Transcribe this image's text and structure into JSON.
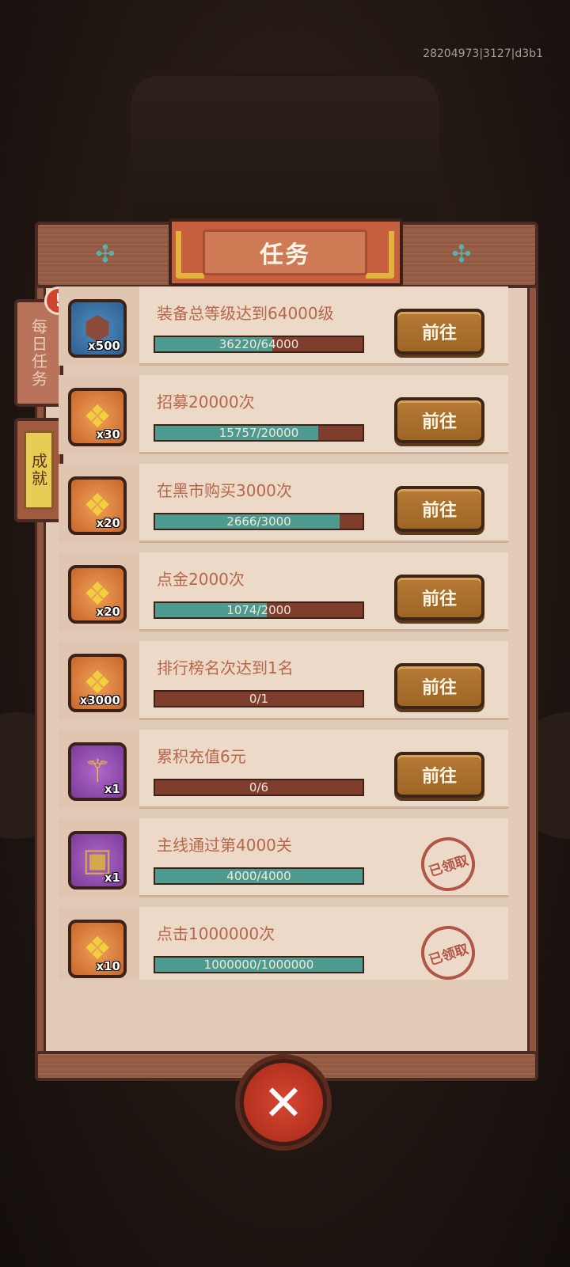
{
  "build_id": "28204973|3127|d3b1",
  "title": "任务",
  "tabs": {
    "daily": "每日任务",
    "achievement": "成就"
  },
  "alert_badge": "!",
  "tasks": [
    {
      "name": "装备总等级达到64000级",
      "reward_count": "x500",
      "reward_icon": "equipment-stone-icon",
      "progress_text": "36220/64000",
      "progress": 0.566,
      "action": "前往",
      "claimed": false
    },
    {
      "name": "招募20000次",
      "reward_count": "x30",
      "reward_icon": "gold-scroll-icon",
      "progress_text": "15757/20000",
      "progress": 0.788,
      "action": "前往",
      "claimed": false
    },
    {
      "name": "在黑市购买3000次",
      "reward_count": "x20",
      "reward_icon": "gold-scroll-icon",
      "progress_text": "2666/3000",
      "progress": 0.889,
      "action": "前往",
      "claimed": false
    },
    {
      "name": "点金2000次",
      "reward_count": "x20",
      "reward_icon": "gold-scroll-icon",
      "progress_text": "1074/2000",
      "progress": 0.537,
      "action": "前往",
      "claimed": false
    },
    {
      "name": "排行榜名次达到1名",
      "reward_count": "x3000",
      "reward_icon": "gold-scroll-icon",
      "progress_text": "0/1",
      "progress": 0,
      "action": "前往",
      "claimed": false
    },
    {
      "name": "累积充值6元",
      "reward_count": "x1",
      "reward_icon": "golden-scepter-icon",
      "progress_text": "0/6",
      "progress": 0,
      "action": "前往",
      "claimed": false
    },
    {
      "name": "主线通过第4000关",
      "reward_count": "x1",
      "reward_icon": "treasure-chest-icon",
      "progress_text": "4000/4000",
      "progress": 1,
      "action": "已领取",
      "claimed": true
    },
    {
      "name": "点击1000000次",
      "reward_count": "x10",
      "reward_icon": "gold-scroll-icon",
      "progress_text": "1000000/1000000",
      "progress": 1,
      "action": "已领取",
      "claimed": true
    }
  ],
  "close_symbol": "✕"
}
